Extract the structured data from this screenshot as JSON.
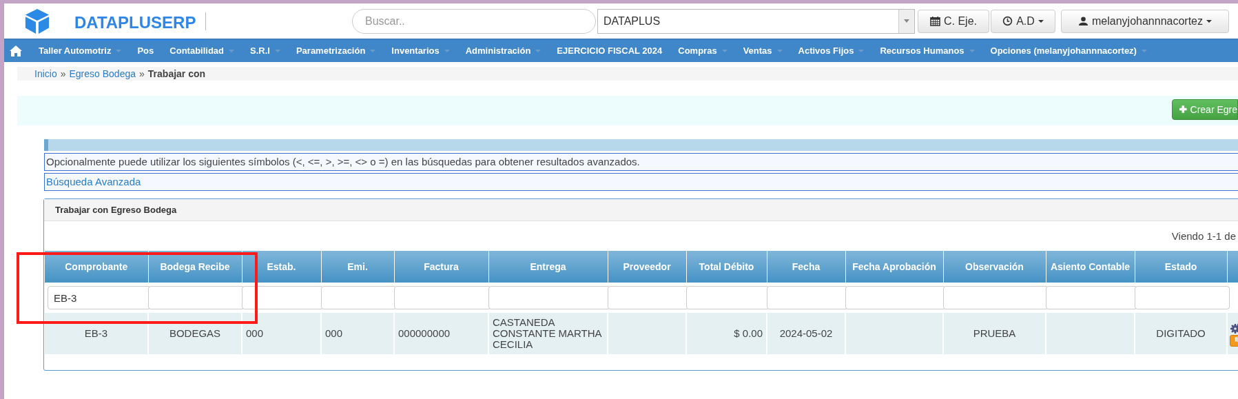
{
  "header": {
    "brand": "DATAPLUSERP",
    "search": {
      "placeholder": "Buscar.."
    },
    "company_select": {
      "value": "DATAPLUS"
    },
    "buttons": [
      {
        "kind": "calendar",
        "label": "C. Eje.",
        "has_menu": false
      },
      {
        "kind": "clock",
        "label": "A.D",
        "has_menu": true
      },
      {
        "kind": "user",
        "label": "melanyjohannnacortez",
        "has_menu": true
      }
    ]
  },
  "nav": [
    {
      "label": "Taller Automotriz",
      "has_menu": true
    },
    {
      "label": "Pos",
      "has_menu": false
    },
    {
      "label": "Contabilidad",
      "has_menu": true
    },
    {
      "label": "S.R.I",
      "has_menu": true
    },
    {
      "label": "Parametrización",
      "has_menu": true
    },
    {
      "label": "Inventarios",
      "has_menu": true
    },
    {
      "label": "Administración",
      "has_menu": true
    },
    {
      "label": "EJERCICIO FISCAL 2024",
      "has_menu": false
    },
    {
      "label": "Compras",
      "has_menu": true
    },
    {
      "label": "Ventas",
      "has_menu": true
    },
    {
      "label": "Activos Fijos",
      "has_menu": true
    },
    {
      "label": "Recursos Humanos",
      "has_menu": true
    },
    {
      "label": "Opciones (melanyjohannnacortez)",
      "has_menu": true
    }
  ],
  "breadcrumb": {
    "separator": "»",
    "items": [
      {
        "label": "Inicio",
        "kind": "link"
      },
      {
        "label": "Egreso Bodega",
        "kind": "link"
      },
      {
        "label": "Trabajar con",
        "kind": "current"
      }
    ]
  },
  "create_button": {
    "label": "Crear Egre"
  },
  "hint": "Opcionalmente puede utilizar los siguientes símbolos (<, <=, >, >=, <> o =) en las búsquedas para obtener resultados avanzados.",
  "advanced_search": "Búsqueda Avanzada",
  "panel": {
    "title": "Trabajar con Egreso Bodega",
    "pager": "Viendo 1-1 de",
    "table": {
      "columns": [
        "Comprobante",
        "Bodega Recibe",
        "Estab.",
        "Emi.",
        "Factura",
        "Entrega",
        "Proveedor",
        "Total Débito",
        "Fecha",
        "Fecha Aprobación",
        "Observación",
        "Asiento Contable",
        "Estado"
      ],
      "filters": {
        "comprobante": "EB-3"
      },
      "rows": [
        {
          "comprobante": "EB-3",
          "bodega_recibe": "BODEGAS",
          "estab": "000",
          "emi": "000",
          "factura": "000000000",
          "entrega": "CASTANEDA CONSTANTE MARTHA CECILIA",
          "total_debito": "$ 0.00",
          "fecha": "2024-05-02",
          "observacion": "PRUEBA",
          "estado": "DIGITADO"
        }
      ]
    }
  },
  "annotation": {
    "kind": "rectangle"
  }
}
